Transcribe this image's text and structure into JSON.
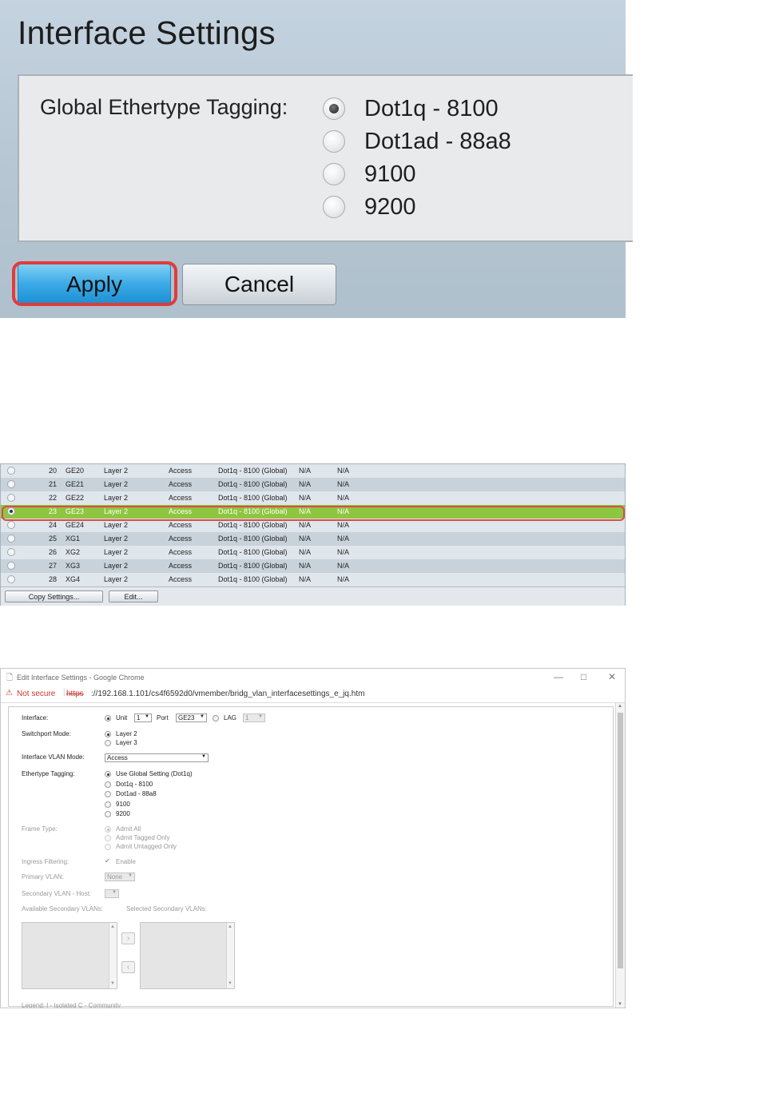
{
  "panel1": {
    "title": "Interface Settings",
    "field_label": "Global Ethertype Tagging:",
    "options": [
      {
        "label": "Dot1q - 8100",
        "selected": true
      },
      {
        "label": "Dot1ad - 88a8",
        "selected": false
      },
      {
        "label": "9100",
        "selected": false
      },
      {
        "label": "9200",
        "selected": false
      }
    ],
    "apply_label": "Apply",
    "cancel_label": "Cancel",
    "highlight_color": "#e23b3b"
  },
  "panel2": {
    "rows": [
      {
        "num": "20",
        "port": "GE20",
        "mode": "Layer 2",
        "vlan_mode": "Access",
        "tagging": "Dot1q - 8100 (Global)",
        "c1": "N/A",
        "c2": "N/A",
        "selected": false
      },
      {
        "num": "21",
        "port": "GE21",
        "mode": "Layer 2",
        "vlan_mode": "Access",
        "tagging": "Dot1q - 8100 (Global)",
        "c1": "N/A",
        "c2": "N/A",
        "selected": false
      },
      {
        "num": "22",
        "port": "GE22",
        "mode": "Layer 2",
        "vlan_mode": "Access",
        "tagging": "Dot1q - 8100 (Global)",
        "c1": "N/A",
        "c2": "N/A",
        "selected": false
      },
      {
        "num": "23",
        "port": "GE23",
        "mode": "Layer 2",
        "vlan_mode": "Access",
        "tagging": "Dot1q - 8100 (Global)",
        "c1": "N/A",
        "c2": "N/A",
        "selected": true
      },
      {
        "num": "24",
        "port": "GE24",
        "mode": "Layer 2",
        "vlan_mode": "Access",
        "tagging": "Dot1q - 8100 (Global)",
        "c1": "N/A",
        "c2": "N/A",
        "selected": false
      },
      {
        "num": "25",
        "port": "XG1",
        "mode": "Layer 2",
        "vlan_mode": "Access",
        "tagging": "Dot1q - 8100 (Global)",
        "c1": "N/A",
        "c2": "N/A",
        "selected": false
      },
      {
        "num": "26",
        "port": "XG2",
        "mode": "Layer 2",
        "vlan_mode": "Access",
        "tagging": "Dot1q - 8100 (Global)",
        "c1": "N/A",
        "c2": "N/A",
        "selected": false
      },
      {
        "num": "27",
        "port": "XG3",
        "mode": "Layer 2",
        "vlan_mode": "Access",
        "tagging": "Dot1q - 8100 (Global)",
        "c1": "N/A",
        "c2": "N/A",
        "selected": false
      },
      {
        "num": "28",
        "port": "XG4",
        "mode": "Layer 2",
        "vlan_mode": "Access",
        "tagging": "Dot1q - 8100 (Global)",
        "c1": "N/A",
        "c2": "N/A",
        "selected": false
      }
    ],
    "copy_settings_label": "Copy Settings...",
    "edit_label": "Edit...",
    "selected_row_color": "#8dc63f"
  },
  "panel3": {
    "window_title": "Edit Interface Settings - Google Chrome",
    "not_secure": "Not secure",
    "https": "https",
    "url": "://192.168.1.101/cs4f6592d0/vmember/bridg_vlan_interfacesettings_e_jq.htm",
    "interface_label": "Interface:",
    "unit_label": "Unit",
    "unit_value": "1",
    "port_label": "Port",
    "port_value": "GE23",
    "lag_label": "LAG",
    "lag_value": "1",
    "switchport_label": "Switchport Mode:",
    "switchport_options": [
      "Layer 2",
      "Layer 3"
    ],
    "vlan_mode_label": "Interface VLAN Mode:",
    "vlan_mode_value": "Access",
    "ethertype_label": "Ethertype Tagging:",
    "ethertype_options": [
      "Use Global Setting (Dot1q)",
      "Dot1q - 8100",
      "Dot1ad - 88a8",
      "9100",
      "9200"
    ],
    "frame_type_label": "Frame Type:",
    "frame_type_options": [
      "Admit All",
      "Admit Tagged Only",
      "Admit Untagged Only"
    ],
    "ingress_label": "Ingress Filtering:",
    "ingress_enable": "Enable",
    "primary_vlan_label": "Primary VLAN:",
    "primary_vlan_value": "None",
    "secondary_host_label": "Secondary VLAN - Host:",
    "available_label": "Available Secondary VLANs:",
    "selected_label": "Selected Secondary VLANs:",
    "legend": "Legend: I - Isolated C - Community"
  }
}
